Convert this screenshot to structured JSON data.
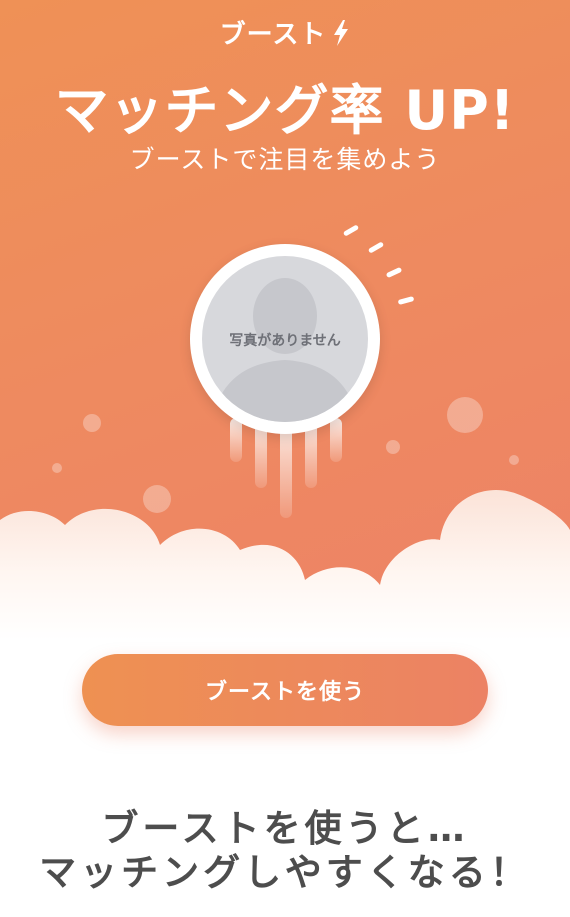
{
  "header": {
    "title": "ブースト",
    "icon": "lightning-bolt-icon"
  },
  "hero": {
    "headline": "マッチング率 UP!",
    "subheadline": "ブーストで注目を集めよう",
    "avatar_placeholder": "写真がありません",
    "colors": {
      "gradient_start": "#ef9156",
      "gradient_end": "#ed8266"
    }
  },
  "cta": {
    "label": "ブーストを使う"
  },
  "benefit": {
    "line1": "ブーストを使うと…",
    "line2": "マッチングしやすくなる！"
  }
}
